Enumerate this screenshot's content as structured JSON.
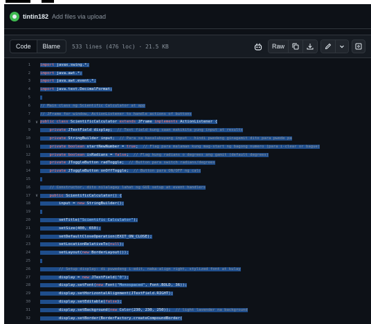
{
  "commit": {
    "user": "tintin182",
    "message": "Add files via upload"
  },
  "toolbar": {
    "tab_code": "Code",
    "tab_blame": "Blame",
    "file_info": "533 lines (476 loc) · 21.5 KB",
    "raw_label": "Raw"
  },
  "icons": {
    "copilot": "copilot-icon",
    "copy": "copy-icon",
    "download": "download-icon",
    "edit": "pencil-icon",
    "dropdown": "chevron-down-icon",
    "symbols": "symbols-panel-icon"
  },
  "colors": {
    "background": "#0d1117",
    "selection": "#1f4e8c",
    "keyword": "#ff7b72",
    "comment": "#8b949e",
    "string": "#a5d6ff"
  },
  "code_lines": [
    {
      "n": "1",
      "fold": "",
      "text": "import javax.swing.*;"
    },
    {
      "n": "2",
      "fold": "",
      "text": "import java.awt.*;"
    },
    {
      "n": "3",
      "fold": "",
      "text": "import java.awt.event.*;"
    },
    {
      "n": "4",
      "fold": "",
      "text": "import java.text.DecimalFormat;"
    },
    {
      "n": "5",
      "fold": "",
      "text": ""
    },
    {
      "n": "6",
      "fold": "",
      "text": "// Main class ng Scientific Calculator at app"
    },
    {
      "n": "7",
      "fold": "",
      "text": "// JFrame for window, ActionListener to handle actions of buttons"
    },
    {
      "n": "8",
      "fold": "∨",
      "text": "public class ScientificCalculator extends JFrame implements ActionListener {"
    },
    {
      "n": "9",
      "fold": "",
      "text": "    private JTextField display;  // Text field kung saan makikita yung input at results"
    },
    {
      "n": "10",
      "fold": "",
      "text": "    private StringBuilder input;  // Para sa kasalukuyang input - hindi pwedeng ginagamit dito para pwede pa"
    },
    {
      "n": "11",
      "fold": "",
      "text": "    private boolean startNewNumber = true;  // Flag para malaman kung mag-start ng bagong numero (para i-clear or bague)"
    },
    {
      "n": "12",
      "fold": "",
      "text": "    private boolean isRadians = false;  // Flag kung radians o degrees ang gamit (default degrees)"
    },
    {
      "n": "13",
      "fold": "",
      "text": "    private JToggleButton radToggle;  // Button para switch radians/degrees"
    },
    {
      "n": "14",
      "fold": "",
      "text": "    private JToggleButton onOffToggle;  // Button para ON/OFF ng calc"
    },
    {
      "n": "15",
      "fold": "",
      "text": ""
    },
    {
      "n": "16",
      "fold": "",
      "text": "    // Constructor, dito nilalagay lahat ng GUI setup at event handlers"
    },
    {
      "n": "17",
      "fold": "∨",
      "text": "    public ScientificCalculator() {"
    },
    {
      "n": "18",
      "fold": "",
      "text": "        input = new StringBuilder();"
    },
    {
      "n": "19",
      "fold": "",
      "text": ""
    },
    {
      "n": "20",
      "fold": "",
      "text": "        setTitle(\"Scientific Calculator\");"
    },
    {
      "n": "21",
      "fold": "",
      "text": "        setSize(400, 650);"
    },
    {
      "n": "22",
      "fold": "",
      "text": "        setDefaultCloseOperation(EXIT_ON_CLOSE);"
    },
    {
      "n": "23",
      "fold": "",
      "text": "        setLocationRelativeTo(null);"
    },
    {
      "n": "24",
      "fold": "",
      "text": "        setLayout(new BorderLayout());"
    },
    {
      "n": "25",
      "fold": "",
      "text": ""
    },
    {
      "n": "26",
      "fold": "",
      "text": "        // Setup display: di puwedeng i-edit, naka-align right, stylized font at kulay"
    },
    {
      "n": "27",
      "fold": "",
      "text": "        display = new JTextField(\"0\");"
    },
    {
      "n": "28",
      "fold": "",
      "text": "        display.setFont(new Font(\"Monospaced\", Font.BOLD, 36));"
    },
    {
      "n": "29",
      "fold": "",
      "text": "        display.setHorizontalAlignment(JTextField.RIGHT);"
    },
    {
      "n": "30",
      "fold": "",
      "text": "        display.setEditable(false);"
    },
    {
      "n": "31",
      "fold": "",
      "text": "        display.setBackground(new Color(230, 230, 250));  // light lavender na background"
    },
    {
      "n": "32",
      "fold": "",
      "text": "        display.setBorder(BorderFactory.createCompoundBorder("
    }
  ]
}
